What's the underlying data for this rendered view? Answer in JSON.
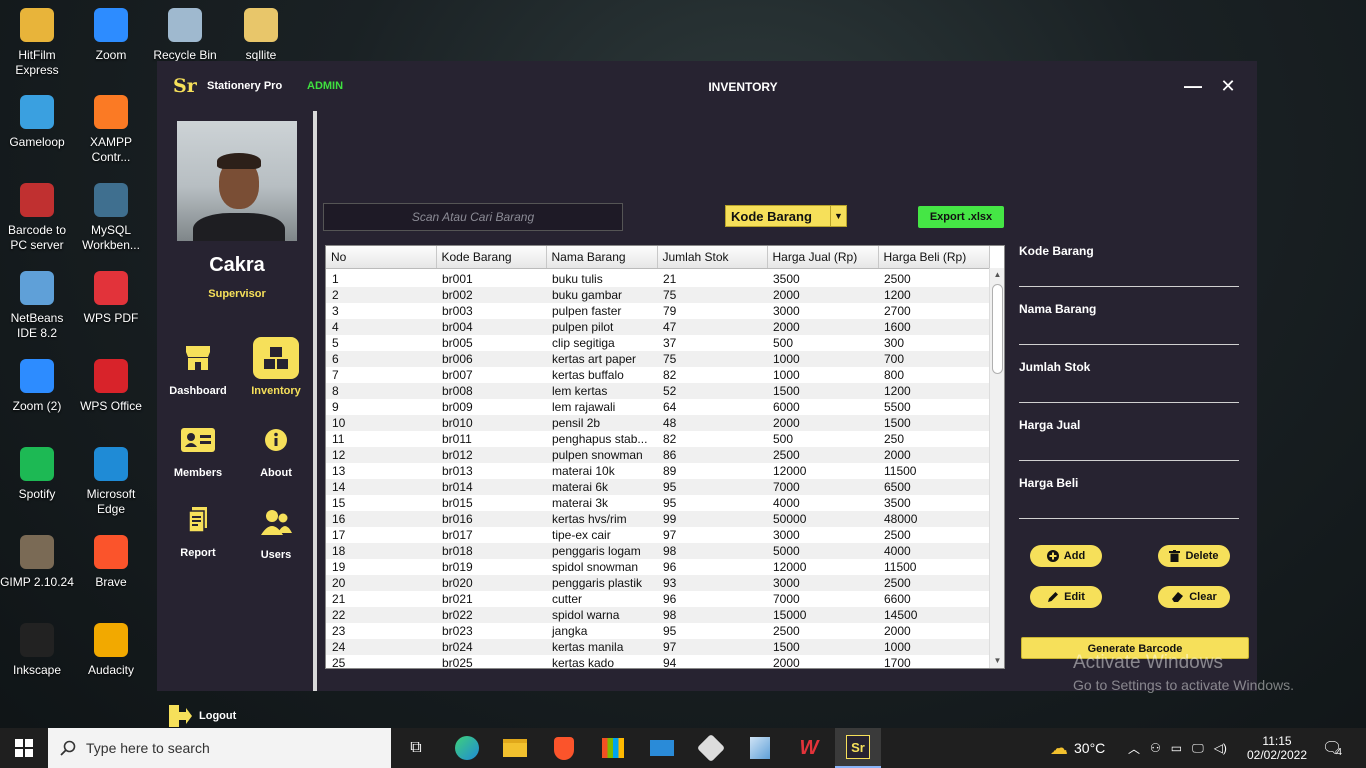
{
  "desktop": {
    "icons": [
      {
        "label": "HitFilm Express",
        "icon": "folder-icon",
        "color": "#e8b43a"
      },
      {
        "label": "Zoom",
        "icon": "zoom-icon",
        "color": "#2d8cff"
      },
      {
        "label": "Recycle Bin",
        "icon": "recycle-bin-icon",
        "color": "#9fb9cf"
      },
      {
        "label": "sqllite",
        "icon": "folder-icon",
        "color": "#e8c66a"
      },
      {
        "label": "Gameloop",
        "icon": "gameloop-icon",
        "color": "#3aa0e0"
      },
      {
        "label": "XAMPP Contr...",
        "icon": "xampp-icon",
        "color": "#fb7a24"
      },
      {
        "label": "Barcode to PC server",
        "icon": "barcode-icon",
        "color": "#c03030"
      },
      {
        "label": "MySQL Workben...",
        "icon": "mysql-icon",
        "color": "#3f6f8f"
      },
      {
        "label": "NetBeans IDE 8.2",
        "icon": "netbeans-icon",
        "color": "#5fa0d8"
      },
      {
        "label": "WPS PDF",
        "icon": "wps-pdf-icon",
        "color": "#e2333a"
      },
      {
        "label": "Zoom (2)",
        "icon": "zoom-icon",
        "color": "#2d8cff"
      },
      {
        "label": "WPS Office",
        "icon": "wps-office-icon",
        "color": "#d8232a"
      },
      {
        "label": "Spotify",
        "icon": "spotify-icon",
        "color": "#1db954"
      },
      {
        "label": "Microsoft Edge",
        "icon": "edge-icon",
        "color": "#1f8bd6"
      },
      {
        "label": "GIMP 2.10.24",
        "icon": "gimp-icon",
        "color": "#7a6a55"
      },
      {
        "label": "Brave",
        "icon": "brave-icon",
        "color": "#fb542b"
      },
      {
        "label": "Inkscape",
        "icon": "inkscape-icon",
        "color": "#222222"
      },
      {
        "label": "Audacity",
        "icon": "audacity-icon",
        "color": "#f2a900"
      }
    ]
  },
  "app": {
    "logo": "Sr",
    "name": "Stationery Pro",
    "role_badge": "ADMIN",
    "page_title": "INVENTORY",
    "window_controls": {
      "minimize": "—",
      "close": "✕"
    }
  },
  "sidebar": {
    "user_name": "Cakra",
    "user_role": "Supervisor",
    "nav": [
      {
        "label": "Dashboard",
        "icon": "store-icon",
        "active": false
      },
      {
        "label": "Inventory",
        "icon": "inventory-boxes-icon",
        "active": true
      },
      {
        "label": "Members",
        "icon": "member-card-icon",
        "active": false
      },
      {
        "label": "About",
        "icon": "info-icon",
        "active": false
      },
      {
        "label": "Report",
        "icon": "report-icon",
        "active": false
      },
      {
        "label": "Users",
        "icon": "users-icon",
        "active": false
      }
    ],
    "logout_label": "Logout"
  },
  "toolbar": {
    "search_placeholder": "Scan Atau Cari Barang",
    "filter_selected": "Kode Barang",
    "export_label": "Export .xlsx"
  },
  "table": {
    "columns": [
      "No",
      "Kode Barang",
      "Nama Barang",
      "Jumlah Stok",
      "Harga Jual (Rp)",
      "Harga Beli (Rp)"
    ],
    "rows": [
      [
        "1",
        "br001",
        "buku tulis",
        "21",
        "3500",
        "2500"
      ],
      [
        "2",
        "br002",
        "buku gambar",
        "75",
        "2000",
        "1200"
      ],
      [
        "3",
        "br003",
        "pulpen faster",
        "79",
        "3000",
        "2700"
      ],
      [
        "4",
        "br004",
        "pulpen pilot",
        "47",
        "2000",
        "1600"
      ],
      [
        "5",
        "br005",
        "clip segitiga",
        "37",
        "500",
        "300"
      ],
      [
        "6",
        "br006",
        "kertas art paper",
        "75",
        "1000",
        "700"
      ],
      [
        "7",
        "br007",
        "kertas buffalo",
        "82",
        "1000",
        "800"
      ],
      [
        "8",
        "br008",
        "lem kertas",
        "52",
        "1500",
        "1200"
      ],
      [
        "9",
        "br009",
        "lem rajawali",
        "64",
        "6000",
        "5500"
      ],
      [
        "10",
        "br010",
        "pensil 2b",
        "48",
        "2000",
        "1500"
      ],
      [
        "11",
        "br011",
        "penghapus stab...",
        "82",
        "500",
        "250"
      ],
      [
        "12",
        "br012",
        "pulpen snowman",
        "86",
        "2500",
        "2000"
      ],
      [
        "13",
        "br013",
        "materai 10k",
        "89",
        "12000",
        "11500"
      ],
      [
        "14",
        "br014",
        "materai 6k",
        "95",
        "7000",
        "6500"
      ],
      [
        "15",
        "br015",
        "materai 3k",
        "95",
        "4000",
        "3500"
      ],
      [
        "16",
        "br016",
        "kertas hvs/rim",
        "99",
        "50000",
        "48000"
      ],
      [
        "17",
        "br017",
        "tipe-ex cair",
        "97",
        "3000",
        "2500"
      ],
      [
        "18",
        "br018",
        "penggaris logam",
        "98",
        "5000",
        "4000"
      ],
      [
        "19",
        "br019",
        "spidol snowman",
        "96",
        "12000",
        "11500"
      ],
      [
        "20",
        "br020",
        "penggaris plastik",
        "93",
        "3000",
        "2500"
      ],
      [
        "21",
        "br021",
        "cutter",
        "96",
        "7000",
        "6600"
      ],
      [
        "22",
        "br022",
        "spidol warna",
        "98",
        "15000",
        "14500"
      ],
      [
        "23",
        "br023",
        "jangka",
        "95",
        "2500",
        "2000"
      ],
      [
        "24",
        "br024",
        "kertas manila",
        "97",
        "1500",
        "1000"
      ],
      [
        "25",
        "br025",
        "kertas kado",
        "94",
        "2000",
        "1700"
      ]
    ]
  },
  "form": {
    "fields": [
      "Kode Barang",
      "Nama Barang",
      "Jumlah Stok",
      "Harga Jual",
      "Harga Beli"
    ],
    "buttons": {
      "add": "Add",
      "delete": "Delete",
      "edit": "Edit",
      "clear": "Clear"
    },
    "barcode_label": "Generate Barcode"
  },
  "watermark": {
    "title": "Activate Windows",
    "subtitle": "Go to Settings to activate Windows."
  },
  "taskbar": {
    "search_placeholder": "Type here to search",
    "weather": "30°C",
    "time": "11:15",
    "date": "02/02/2022",
    "notification_count": "4"
  },
  "colors": {
    "accent_yellow": "#f6e05a",
    "admin_green": "#3fe03f",
    "export_green": "#45e645",
    "app_bg": "#272331"
  }
}
